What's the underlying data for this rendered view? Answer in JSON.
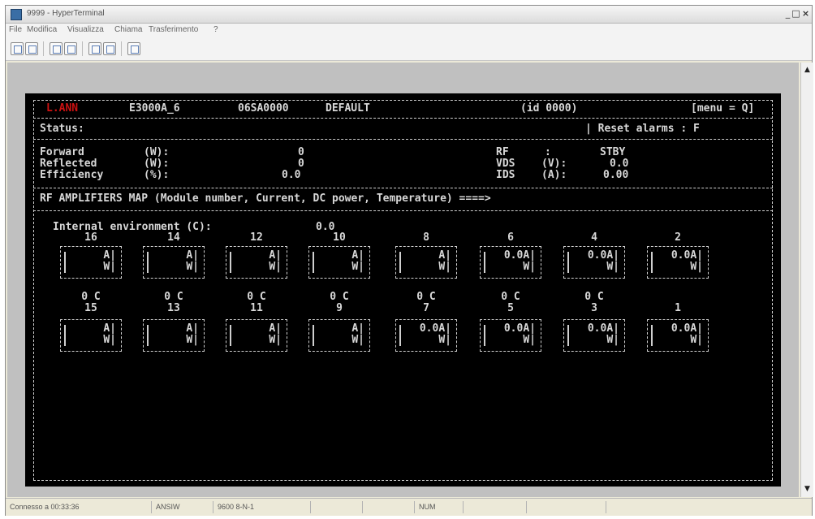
{
  "window": {
    "title": "9999 - HyperTerminal",
    "minimize": "_",
    "maximize": "□",
    "close": "×"
  },
  "menu": [
    "File",
    "Modifica",
    "Visualizza",
    "Chiama",
    "Trasferimento",
    "?"
  ],
  "toolbar_icons": [
    "new-icon",
    "open-icon",
    "phone-icon",
    "disconnect-icon",
    "send-icon",
    "receive-icon",
    "properties-icon"
  ],
  "terminal": {
    "header": {
      "alarm": "L.ANN",
      "model": "E3000A_6",
      "serial": "06SA0000",
      "profile": "DEFAULT",
      "id": "(id 0000)",
      "menu": "[menu = Q]"
    },
    "status_label": "Status:",
    "reset_alarms": "| Reset alarms : F",
    "measures": [
      {
        "label": "Forward",
        "unit": "(W):",
        "value": "0"
      },
      {
        "label": "Reflected",
        "unit": "(W):",
        "value": "0"
      },
      {
        "label": "Efficiency",
        "unit": "(%):",
        "value": "0.0"
      }
    ],
    "rf": {
      "label": "RF",
      "sep": ":",
      "value": "STBY"
    },
    "vds": {
      "label": "VDS",
      "unit": "(V):",
      "value": "0.0"
    },
    "ids": {
      "label": "IDS",
      "unit": "(A):",
      "value": "0.00"
    },
    "map_title": "RF AMPLIFIERS MAP (Module number, Current, DC power, Temperature) ====>",
    "internal_env_label": "Internal environment (C):",
    "internal_env_value": "0.0",
    "top_row": [
      {
        "num": "16",
        "current": "A|",
        "power": "W|",
        "temp": "0 C"
      },
      {
        "num": "14",
        "current": "A|",
        "power": "W|",
        "temp": "0 C"
      },
      {
        "num": "12",
        "current": "A|",
        "power": "W|",
        "temp": "0 C"
      },
      {
        "num": "10",
        "current": "A|",
        "power": "W|",
        "temp": "0 C"
      },
      {
        "num": "8",
        "current": "A|",
        "power": "W|",
        "temp": "0 C"
      },
      {
        "num": "6",
        "current": "0.0A|",
        "power": "W|",
        "temp": "0 C"
      },
      {
        "num": "4",
        "current": "0.0A|",
        "power": "W|",
        "temp": "0 C"
      },
      {
        "num": "2",
        "current": "0.0A|",
        "power": "W|",
        "temp": ""
      }
    ],
    "bottom_row": [
      {
        "num": "15",
        "current": "A|",
        "power": "W|"
      },
      {
        "num": "13",
        "current": "A|",
        "power": "W|"
      },
      {
        "num": "11",
        "current": "A|",
        "power": "W|"
      },
      {
        "num": "9",
        "current": "A|",
        "power": "W|"
      },
      {
        "num": "7",
        "current": "0.0A|",
        "power": "W|"
      },
      {
        "num": "5",
        "current": "0.0A|",
        "power": "W|"
      },
      {
        "num": "3",
        "current": "0.0A|",
        "power": "W|"
      },
      {
        "num": "1",
        "current": "0.0A|",
        "power": "W|"
      }
    ]
  },
  "statusbar": [
    "Connesso a 00:33:36",
    "ANSIW",
    "9600 8-N-1",
    "",
    "",
    "NUM",
    "",
    ""
  ],
  "colors": {
    "alarm": "#cc1111",
    "terminal_bg": "#000000",
    "terminal_fg": "#d8d8d8"
  }
}
